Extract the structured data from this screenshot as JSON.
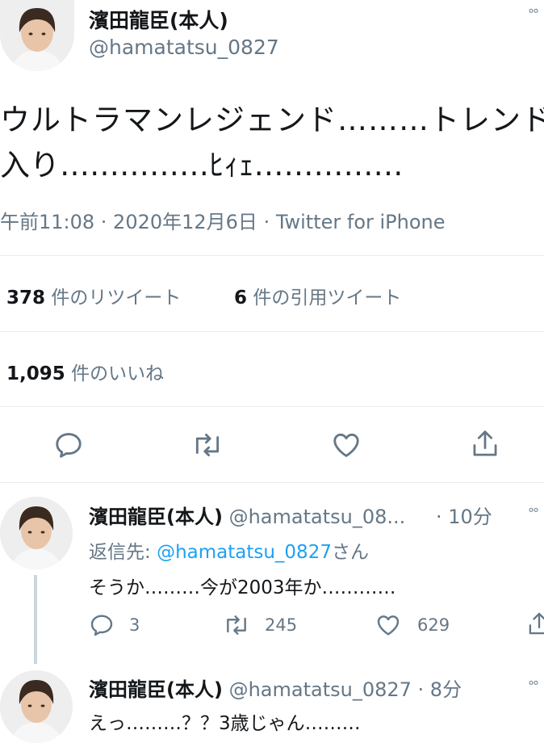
{
  "tweet": {
    "author_name": "濱田龍臣(本人)",
    "author_handle": "@hamatatsu_0827",
    "text_line1": "ウルトラマンレジェンド………トレンド",
    "text_line2": "入り……………ﾋｨｪ……………",
    "timestamp": "午前11:08 · 2020年12月6日 · Twitter for iPhone",
    "retweets_count": "378",
    "retweets_label": "件のリツイート",
    "quotes_count": "6",
    "quotes_label": "件の引用ツイート",
    "likes_count": "1,095",
    "likes_label": "件のいいね"
  },
  "actions": [
    "reply-icon",
    "retweet-icon",
    "like-icon",
    "share-icon"
  ],
  "replies": [
    {
      "author_name": "濱田龍臣(本人)",
      "author_handle": "@hamatatsu_08...",
      "time": "· 10分",
      "reply_to_prefix": "返信先: ",
      "reply_to_handle": "@hamatatsu_0827",
      "reply_to_suffix": "さん",
      "text": "そうか………今が2003年か…………",
      "reply_count": "3",
      "retweet_count": "245",
      "like_count": "629"
    },
    {
      "author_name": "濱田龍臣(本人)",
      "author_handle": "@hamatatsu_0827",
      "time": "· 8分",
      "text": "えっ………？？3歳じゃん………"
    }
  ],
  "colors": {
    "text": "#14171a",
    "muted": "#657786",
    "link": "#1da1f2",
    "divider": "#e6ecf0"
  }
}
